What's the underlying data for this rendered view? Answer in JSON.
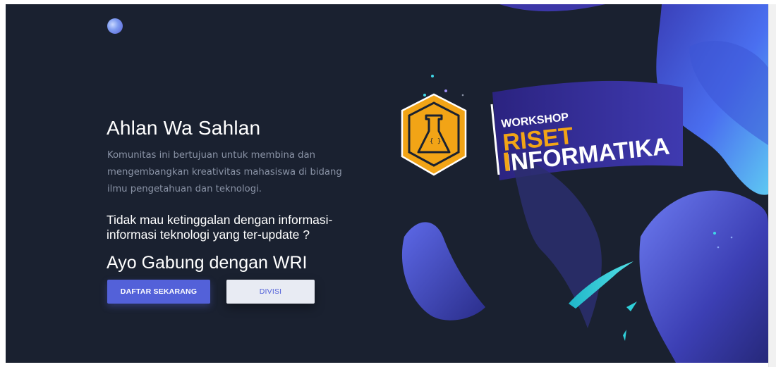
{
  "hero": {
    "title": "Ahlan Wa Sahlan",
    "description": "Komunitas ini bertujuan untuk membina dan mengembangkan kreativitas mahasiswa di bidang ilmu pengetahuan dan teknologi.",
    "question": "Tidak mau ketinggalan dengan informasi-informasi teknologi yang ter-update ?",
    "cta_title": "Ayo Gabung dengan WRI",
    "primary_button": "DAFTAR SEKARANG",
    "secondary_button": "DIVISI"
  },
  "banner": {
    "line1": "WORKSHOP",
    "line2": "RISET",
    "line3": "INFORMATIKA"
  },
  "colors": {
    "background": "#1a2130",
    "accent": "#5361d9",
    "text_muted": "#8a93a6",
    "logo_hex": "#f2a416",
    "brand_orange": "#f2a416",
    "brand_purple": "#3b2f9e",
    "shape_blue": "#4a63e6"
  },
  "icons": {
    "logo": "site-logo-icon",
    "flask": "flask-icon"
  }
}
